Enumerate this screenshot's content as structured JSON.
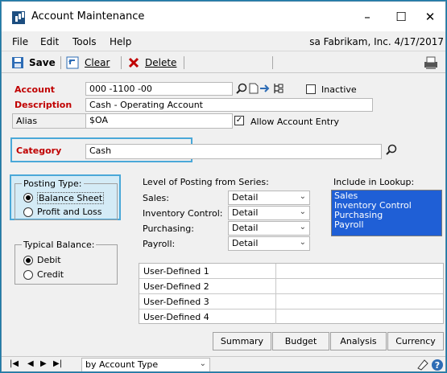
{
  "window": {
    "title": "Account Maintenance",
    "buttons": {
      "minimize": "–",
      "maximize": "☐",
      "close": "✕"
    }
  },
  "menu": {
    "items": [
      "File",
      "Edit",
      "Tools",
      "Help"
    ],
    "company_info": "sa  Fabrikam, Inc.  4/17/2017"
  },
  "toolbar": {
    "save_label": "Save",
    "clear_label": "Clear",
    "delete_label": "Delete"
  },
  "form": {
    "account": {
      "label": "Account",
      "value": "000 -1100 -00"
    },
    "description": {
      "label": "Description",
      "value": "Cash - Operating Account"
    },
    "alias": {
      "label": "Alias",
      "value": "$OA"
    },
    "inactive": {
      "label": "Inactive",
      "checked": false
    },
    "allow_entry": {
      "label": "Allow Account Entry",
      "checked": true
    },
    "category": {
      "label": "Category",
      "value": "Cash"
    },
    "posting_type": {
      "title": "Posting Type:",
      "options": [
        "Balance Sheet",
        "Profit and Loss"
      ],
      "selected": "Balance Sheet"
    },
    "typical_balance": {
      "title": "Typical Balance:",
      "options": [
        "Debit",
        "Credit"
      ],
      "selected": "Debit"
    },
    "level_of_posting": {
      "title": "Level of Posting from Series:",
      "rows": [
        {
          "label": "Sales:",
          "value": "Detail"
        },
        {
          "label": "Inventory Control:",
          "value": "Detail"
        },
        {
          "label": "Purchasing:",
          "value": "Detail"
        },
        {
          "label": "Payroll:",
          "value": "Detail"
        }
      ]
    },
    "include_in_lookup": {
      "title": "Include in Lookup:",
      "items": [
        "Sales",
        "Inventory Control",
        "Purchasing",
        "Payroll"
      ]
    },
    "user_defined": [
      {
        "label": "User-Defined 1",
        "value": ""
      },
      {
        "label": "User-Defined 2",
        "value": ""
      },
      {
        "label": "User-Defined 3",
        "value": ""
      },
      {
        "label": "User-Defined 4",
        "value": ""
      }
    ]
  },
  "actions": {
    "summary": "Summary",
    "budget": "Budget",
    "analysis": "Analysis",
    "currency": "Currency"
  },
  "bottom": {
    "sort_by": "by Account Type"
  },
  "colors": {
    "required_label": "#c00000",
    "selection": "#1f5fd6",
    "highlight_border": "#4aa8d8"
  }
}
